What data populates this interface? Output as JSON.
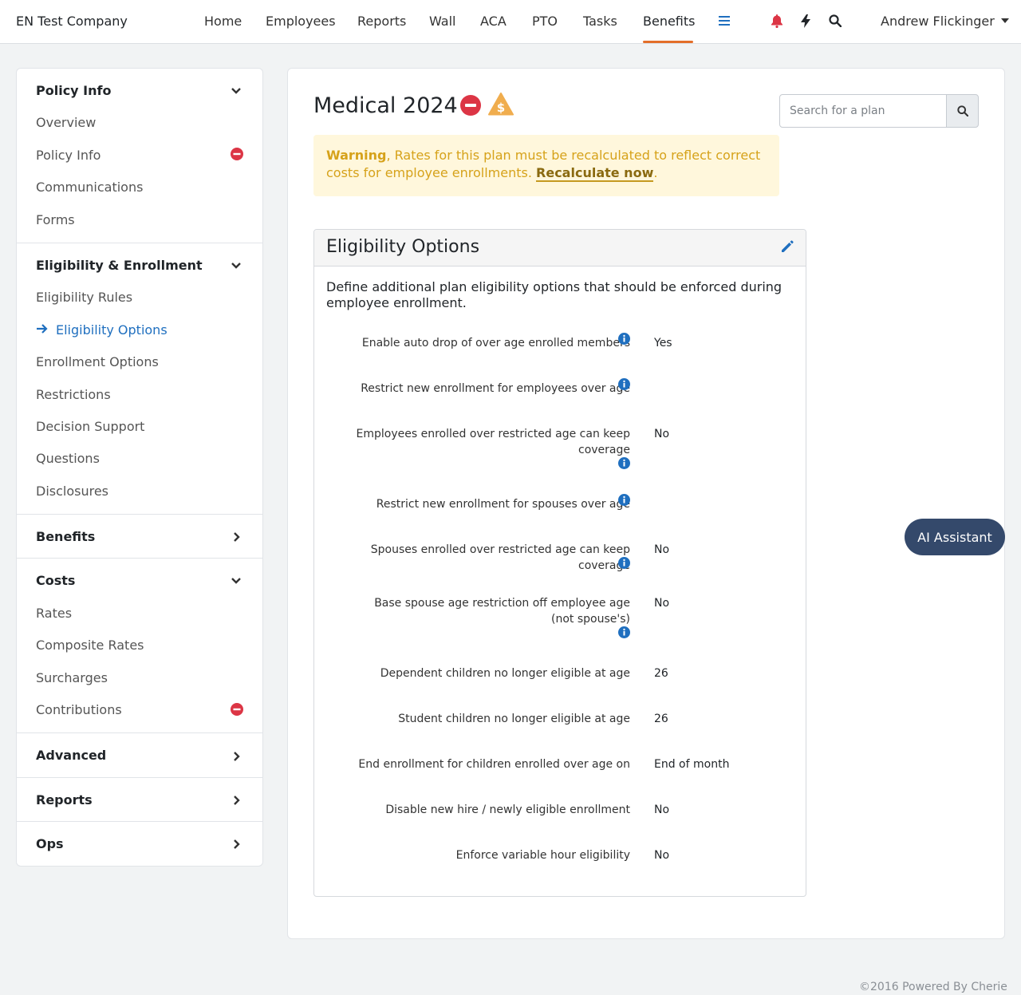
{
  "header": {
    "company": "EN Test Company",
    "nav": [
      "Home",
      "Employees",
      "Reports",
      "Wall",
      "ACA",
      "PTO",
      "Tasks",
      "Benefits"
    ],
    "active_nav": "Benefits",
    "user": "Andrew Flickinger",
    "icons": [
      "menu-icon",
      "bell-icon",
      "bolt-icon",
      "search-icon"
    ]
  },
  "sidebar": {
    "sections": [
      {
        "title": "Policy Info",
        "expanded": true,
        "items": [
          "Overview",
          "Policy Info",
          "Communications",
          "Forms"
        ]
      },
      {
        "title": "Eligibility & Enrollment",
        "expanded": true,
        "items": [
          "Eligibility Rules",
          "Eligibility Options",
          "Enrollment Options",
          "Restrictions",
          "Decision Support",
          "Questions",
          "Disclosures"
        ]
      },
      {
        "title": "Benefits",
        "expanded": false
      },
      {
        "title": "Costs",
        "expanded": true,
        "items": [
          "Rates",
          "Composite Rates",
          "Surcharges",
          "Contributions"
        ]
      },
      {
        "title": "Advanced",
        "expanded": false
      },
      {
        "title": "Reports",
        "expanded": false
      },
      {
        "title": "Ops",
        "expanded": false
      }
    ],
    "active_item": "Eligibility Options"
  },
  "main": {
    "title": "Medical 2024",
    "search_placeholder": "Search for a plan",
    "warning": {
      "label": "Warning",
      "text": ", Rates for this plan must be recalculated to reflect correct costs for employee enrollments. ",
      "link": "Recalculate now",
      "end": "."
    },
    "card": {
      "title": "Eligibility Options",
      "description": "Define additional plan eligibility options that should be enforced during employee enrollment.",
      "options": [
        {
          "label": "Enable auto drop of over age enrolled members",
          "value": "Yes"
        },
        {
          "label": "Restrict new enrollment for employees over age",
          "value": ""
        },
        {
          "label": "Employees enrolled over restricted age can keep coverage",
          "value": "No"
        },
        {
          "label": "Restrict new enrollment for spouses over age",
          "value": ""
        },
        {
          "label": "Spouses enrolled over restricted age can keep coverage",
          "value": "No"
        },
        {
          "label": "Base spouse age restriction off employee age (not spouse's)",
          "value": "No"
        },
        {
          "label": "Dependent children no longer eligible at age",
          "value": "26"
        },
        {
          "label": "Student children no longer eligible at age",
          "value": "26"
        },
        {
          "label": "End enrollment for children enrolled over age on",
          "value": "End of month"
        },
        {
          "label": "Disable new hire / newly eligible enrollment",
          "value": "No"
        },
        {
          "label": "Enforce variable hour eligibility",
          "value": "No"
        }
      ]
    }
  },
  "assistant_label": "AI Assistant",
  "footer": "©2016 Powered By Cherie",
  "colors": {
    "accent": "#1f6fbf",
    "nav_underline": "#e36e29",
    "danger": "#dc3545",
    "warning": "#f0ad4e",
    "assistant": "#34496b"
  }
}
